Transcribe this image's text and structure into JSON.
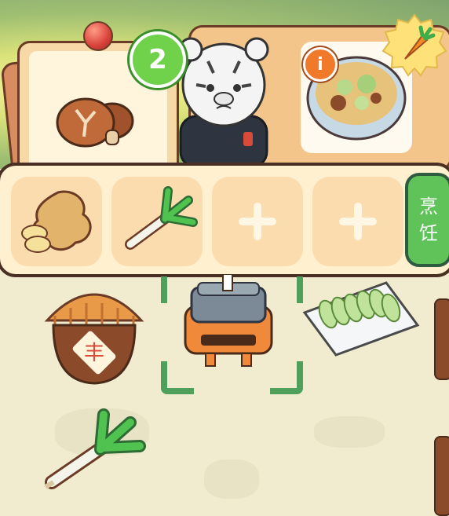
{
  "order": {
    "main_ingredient_icon": "shiitake-mushroom-icon",
    "remaining_count": "2",
    "dish_icon": "mushroom-cabbage-soup-bowl-icon",
    "info_label": "i",
    "reward_icon": "carrot-icon"
  },
  "slots": [
    {
      "icon": "ginger-icon",
      "state": "filled"
    },
    {
      "icon": "green-onion-icon",
      "state": "filled"
    },
    {
      "icon": "plus-icon",
      "state": "empty"
    },
    {
      "icon": "plus-icon",
      "state": "empty"
    }
  ],
  "cook_button": {
    "line1": "烹",
    "line2": "饪"
  },
  "storage_jar": {
    "label": "丰"
  },
  "world_items": [
    "storage-jar",
    "cooking-pot",
    "cut-cucumber-tray",
    "green-onion"
  ],
  "colors": {
    "accent_green": "#5fc35a",
    "badge_green": "#6fd24a",
    "info_orange": "#f07a2a",
    "outline_brown": "#4a3022"
  }
}
